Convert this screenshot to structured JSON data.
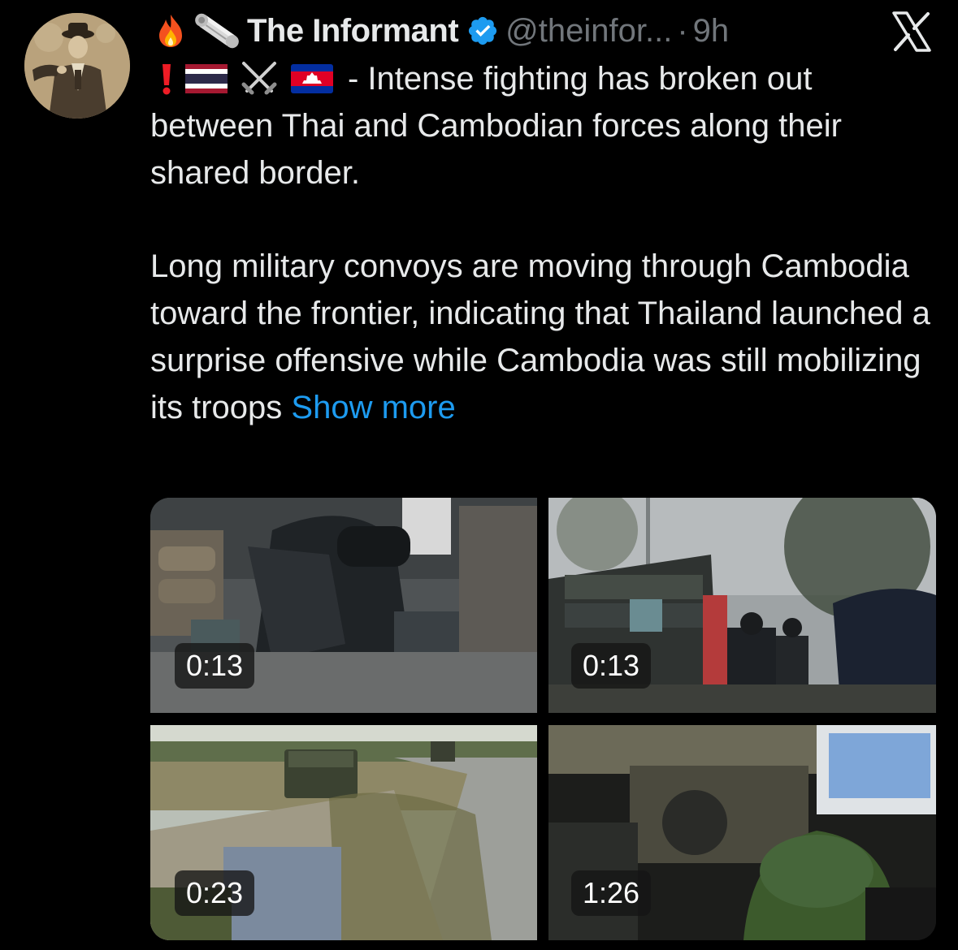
{
  "tweet": {
    "author_name": "The Informant",
    "handle": "@theinfor...",
    "separator": "·",
    "time": "9h",
    "line1_text": "- Intense fighting has broken out",
    "line1_rest": "between Thai and Cambodian forces along their shared border.",
    "paragraph2": "Long military convoys are moving through Cambodia toward the frontier, indicating that Thailand launched a surprise offensive while Cambodia was still mobilizing its troops ",
    "show_more": "Show more"
  },
  "icons": {
    "header_emojis": [
      "fire-icon",
      "scroll-icon"
    ],
    "flag_line": [
      "exclamation-icon",
      "thailand-flag-icon",
      "crossed-swords-icon",
      "cambodia-flag-icon"
    ],
    "verified": "verified-badge-icon",
    "platform": "x-logo-icon"
  },
  "media": [
    {
      "duration": "0:13"
    },
    {
      "duration": "0:13"
    },
    {
      "duration": "0:23"
    },
    {
      "duration": "1:26"
    }
  ],
  "colors": {
    "background": "#000000",
    "text": "#e7e9ea",
    "muted": "#71767b",
    "link": "#1d9bf0",
    "verified": "#1d9bf0"
  }
}
